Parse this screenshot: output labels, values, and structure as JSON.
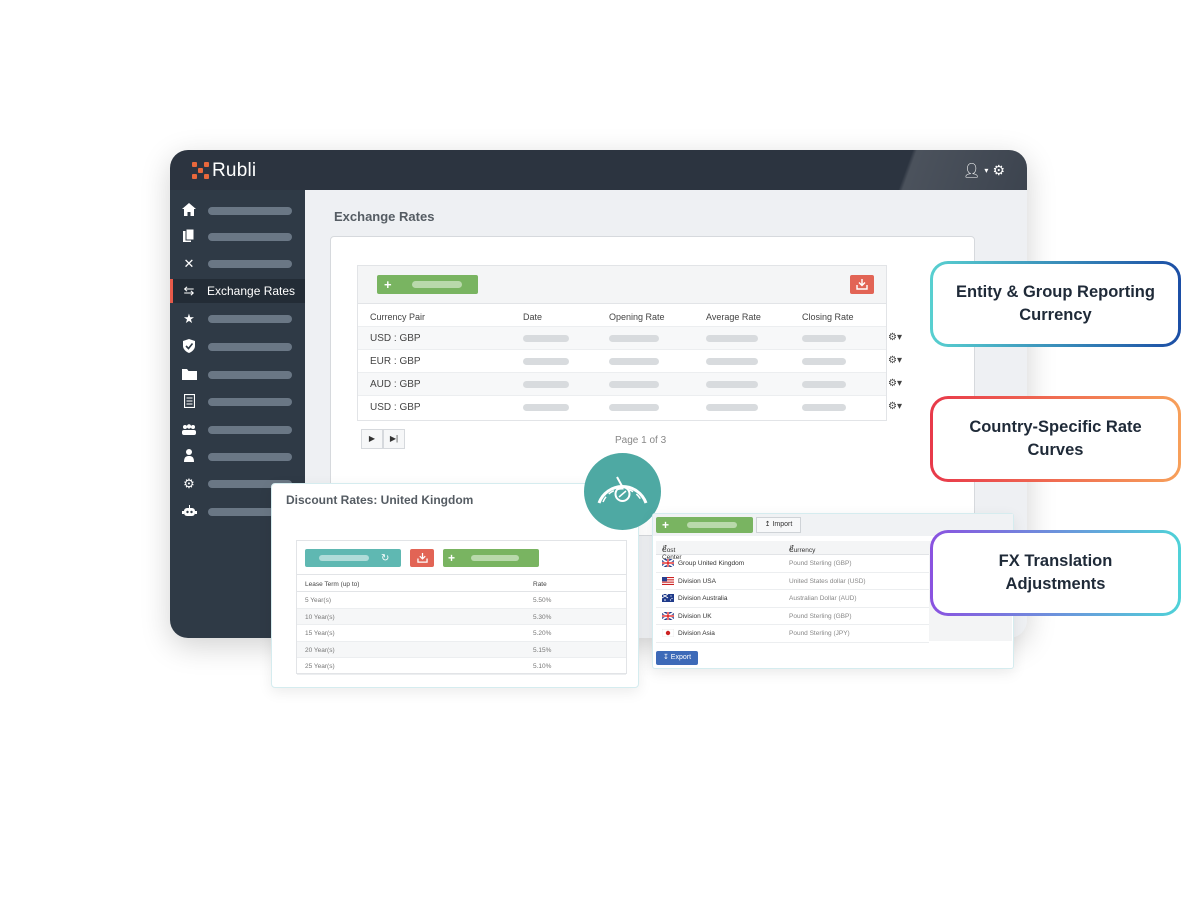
{
  "app": {
    "logo_text": "Rubli",
    "user_icon": "user-icon",
    "settings_icon": "gear-icon"
  },
  "sidebar": {
    "items": [
      {
        "icon": "home-icon",
        "label": ""
      },
      {
        "icon": "documents-icon",
        "label": ""
      },
      {
        "icon": "tools-icon",
        "label": ""
      },
      {
        "icon": "exchange-icon",
        "label": "Exchange Rates",
        "active": true
      },
      {
        "icon": "star-icon",
        "label": ""
      },
      {
        "icon": "shield-icon",
        "label": ""
      },
      {
        "icon": "folder-icon",
        "label": ""
      },
      {
        "icon": "report-icon",
        "label": ""
      },
      {
        "icon": "group-icon",
        "label": ""
      },
      {
        "icon": "person-icon",
        "label": ""
      },
      {
        "icon": "gear-icon",
        "label": ""
      },
      {
        "icon": "robot-icon",
        "label": ""
      }
    ]
  },
  "exchange_rates": {
    "title": "Exchange Rates",
    "columns": [
      "Currency Pair",
      "Date",
      "Opening Rate",
      "Average Rate",
      "Closing Rate"
    ],
    "rows": [
      {
        "pair": "USD : GBP"
      },
      {
        "pair": "EUR : GBP"
      },
      {
        "pair": "AUD : GBP"
      },
      {
        "pair": "USD : GBP"
      }
    ],
    "page_info": "Page 1 of 3"
  },
  "discount_rates": {
    "title": "Discount Rates: United Kingdom",
    "columns": [
      "Lease Term (up to)",
      "Rate"
    ],
    "rows": [
      {
        "term": "5 Year(s)",
        "rate": "5.50%"
      },
      {
        "term": "10 Year(s)",
        "rate": "5.30%"
      },
      {
        "term": "15 Year(s)",
        "rate": "5.20%"
      },
      {
        "term": "20 Year(s)",
        "rate": "5.15%"
      },
      {
        "term": "25 Year(s)",
        "rate": "5.10%"
      }
    ]
  },
  "cost_centers": {
    "import_label": "Import",
    "export_label": "Export",
    "columns": [
      "Cost Center",
      "Currency"
    ],
    "rows": [
      {
        "flag": "uk",
        "name": "Group United Kingdom",
        "currency": "Pound Sterling (GBP)"
      },
      {
        "flag": "us",
        "name": "Division USA",
        "currency": "United States dollar (USD)"
      },
      {
        "flag": "au",
        "name": "Division Australia",
        "currency": "Australian Dollar (AUD)"
      },
      {
        "flag": "uk",
        "name": "Division UK",
        "currency": "Pound Sterling (GBP)"
      },
      {
        "flag": "jp",
        "name": "Division Asia",
        "currency": "Pound Sterling (JPY)"
      }
    ]
  },
  "callouts": [
    {
      "text": "Entity & Group Reporting Currency"
    },
    {
      "text": "Country-Specific Rate Curves"
    },
    {
      "text": "FX Translation Adjustments"
    }
  ],
  "colors": {
    "accent_green": "#79b461",
    "accent_red": "#e26455",
    "accent_teal": "#4ea9a3",
    "sidebar_bg": "#2f3a46",
    "export_blue": "#3d6ab8"
  }
}
